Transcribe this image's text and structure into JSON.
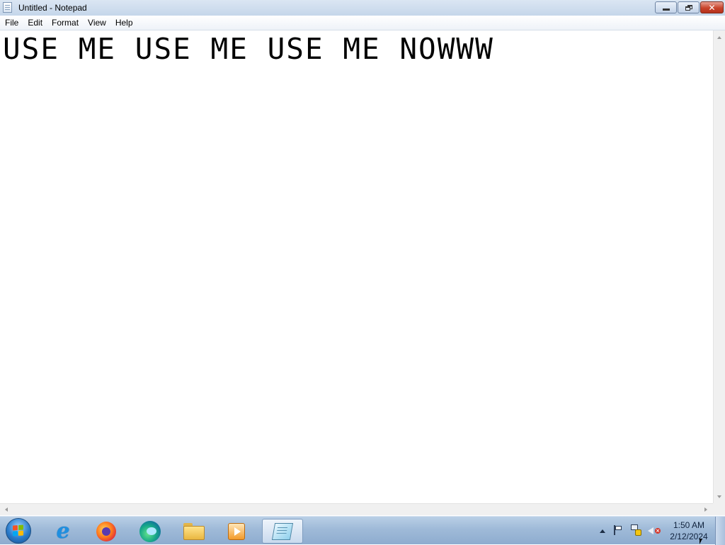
{
  "window": {
    "title": "Untitled - Notepad",
    "icon": "notepad-icon"
  },
  "caption_buttons": {
    "minimize_icon": "minimize-icon",
    "maximize_icon": "restore-icon",
    "close_icon": "close-icon"
  },
  "menubar": {
    "items": [
      "File",
      "Edit",
      "Format",
      "View",
      "Help"
    ]
  },
  "editor": {
    "content": "USE ME USE ME USE ME NOWWW"
  },
  "taskbar": {
    "start_icon": "windows-start-icon",
    "pinned_apps": [
      {
        "name": "Internet Explorer",
        "icon": "internet-explorer-icon"
      },
      {
        "name": "Firefox",
        "icon": "firefox-icon"
      },
      {
        "name": "Microsoft Edge",
        "icon": "edge-icon"
      },
      {
        "name": "Windows Explorer",
        "icon": "folder-icon"
      },
      {
        "name": "Windows Media Player",
        "icon": "media-player-icon"
      },
      {
        "name": "Notepad",
        "icon": "notepad-icon",
        "active": true
      }
    ],
    "tray": {
      "icons": [
        "show-hidden-icons-arrow",
        "action-center-flag-icon",
        "network-icon",
        "volume-muted-icon"
      ],
      "time": "1:50 AM",
      "date": "2/12/2024"
    }
  }
}
